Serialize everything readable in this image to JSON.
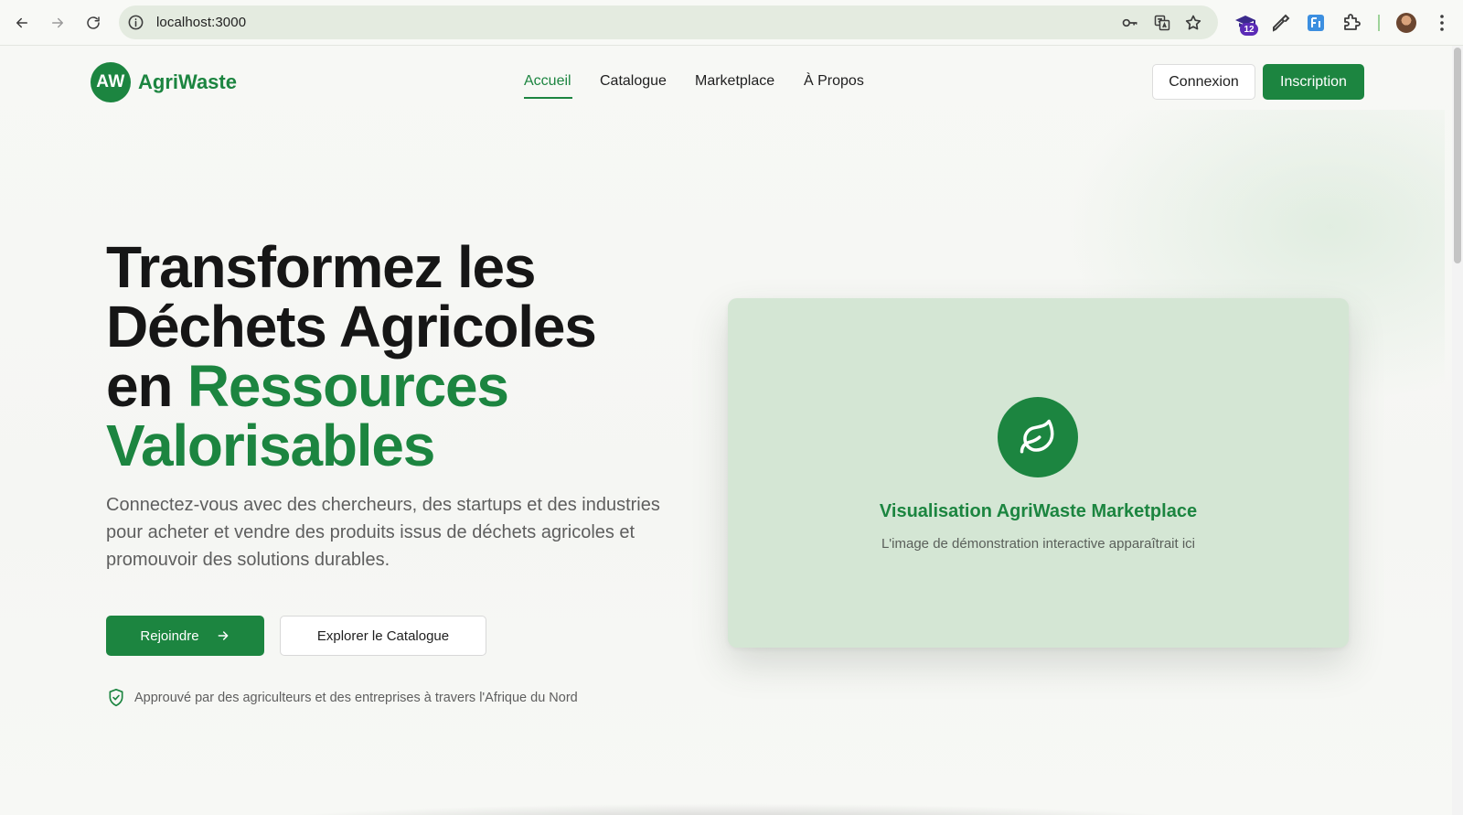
{
  "browser": {
    "url": "localhost:3000",
    "extension_badge": "12"
  },
  "brand": {
    "logo_initials": "AW",
    "name": "AgriWaste",
    "color": "#1c8540"
  },
  "nav": {
    "items": [
      {
        "label": "Accueil",
        "active": true
      },
      {
        "label": "Catalogue",
        "active": false
      },
      {
        "label": "Marketplace",
        "active": false
      },
      {
        "label": "À Propos",
        "active": false
      }
    ]
  },
  "auth": {
    "login_label": "Connexion",
    "signup_label": "Inscription"
  },
  "hero": {
    "title_line1": "Transformez les",
    "title_line2": "Déchets Agricoles",
    "title_line3_prefix": "en ",
    "title_line3_accent": "Ressources",
    "title_line4_accent": "Valorisables",
    "subtitle": "Connectez-vous avec des chercheurs, des startups et des industries pour acheter et vendre des produits issus de déchets agricoles et promouvoir des solutions durables.",
    "cta_primary": "Rejoindre",
    "cta_secondary": "Explorer le Catalogue",
    "trust_text": "Approuvé par des agriculteurs et des entreprises à travers l'Afrique du Nord"
  },
  "visualization": {
    "title": "Visualisation AgriWaste Marketplace",
    "description": "L'image de démonstration interactive apparaîtrait ici",
    "icon": "leaf-icon"
  }
}
